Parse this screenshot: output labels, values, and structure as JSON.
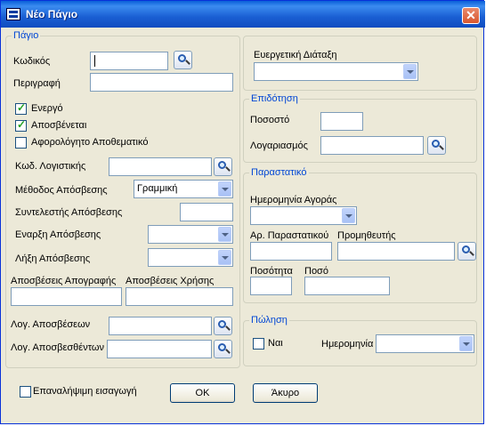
{
  "window": {
    "title": "Νέο Πάγιο",
    "close_label": "✕"
  },
  "asset": {
    "legend": "Πάγιο",
    "code_label": "Κωδικός",
    "description_label": "Περιγραφή",
    "active_label": "Ενεργό",
    "active_checked": true,
    "depreciable_label": "Αποσβένεται",
    "depreciable_checked": true,
    "tax_free_reserve_label": "Αφορολόγητο Αποθεματικό",
    "tax_free_reserve_checked": false,
    "account_code_label": "Κωδ. Λογιστικής",
    "depreciation_method_label": "Μέθοδος Απόσβεσης",
    "depreciation_method_value": "Γραμμική",
    "depreciation_rate_label": "Συντελεστής Απόσβεσης",
    "depreciation_start_label": "Εναρξη Απόσβεσης",
    "depreciation_end_label": "Λήξη Απόσβεσης",
    "inventory_depreciation_label": "Αποσβέσεις Απογραφής",
    "usage_depreciation_label": "Αποσβέσεις Χρήσης",
    "depreciation_account_label": "Λογ. Αποσβέσεων",
    "depreciated_account_label": "Λογ. Αποσβεσθέντων"
  },
  "executive": {
    "label": "Ευεργετική Διάταξη"
  },
  "subsidy": {
    "legend": "Επιδότηση",
    "percent_label": "Ποσοστό",
    "account_label": "Λογαριασμός"
  },
  "document": {
    "legend": "Παραστατικό",
    "purchase_date_label": "Ημερομηνία Αγοράς",
    "doc_number_label": "Αρ. Παραστατικού",
    "supplier_label": "Προμηθευτής",
    "quantity_label": "Ποσότητα",
    "amount_label": "Ποσό"
  },
  "sale": {
    "legend": "Πώληση",
    "yes_label": "Ναι",
    "yes_checked": false,
    "date_label": "Ημερομηνία"
  },
  "footer": {
    "repeat_label": "Επαναλήψιμη εισαγωγή",
    "repeat_checked": false,
    "ok_label": "OK",
    "cancel_label": "Άκυρο"
  }
}
